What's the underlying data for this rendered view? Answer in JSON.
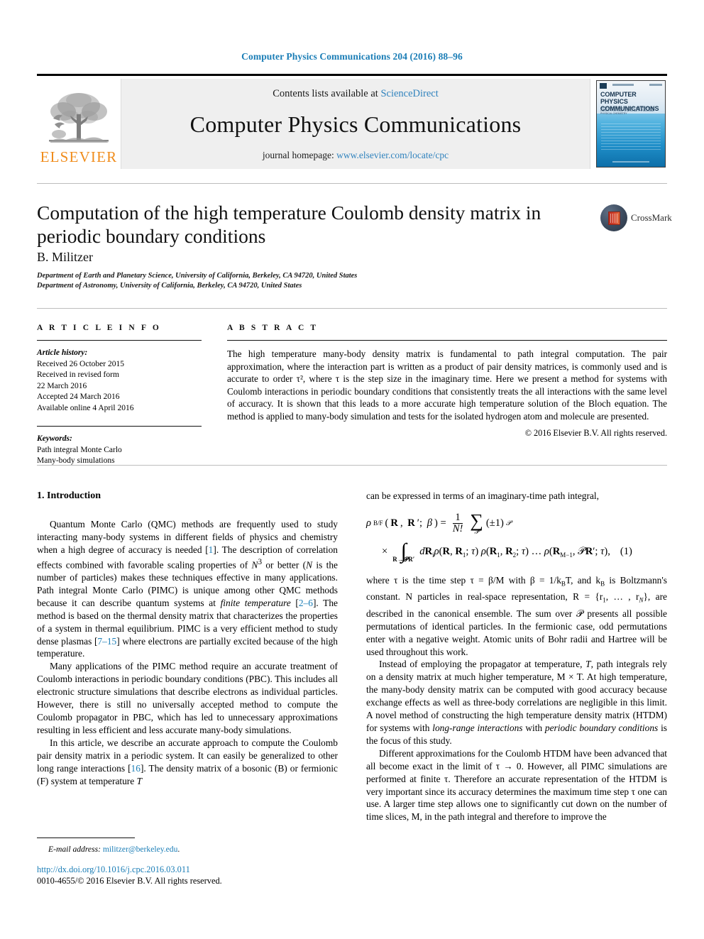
{
  "running_head": "Computer Physics Communications 204 (2016) 88–96",
  "masthead": {
    "elsevier_wordmark": "ELSEVIER",
    "contents_prefix": "Contents lists available at ",
    "contents_link": "ScienceDirect",
    "journal_name": "Computer Physics Communications",
    "homepage_prefix": "journal homepage: ",
    "homepage_link": "www.elsevier.com/locate/cpc",
    "cover_title_line1": "COMPUTER PHYSICS",
    "cover_title_line2": "COMMUNICATIONS",
    "cover_subtitle": "AN INTERNATIONAL JOURNAL AND PROGRAM LIBRARY FOR COMPUTATIONAL PHYSICS AND PHYSICAL CHEMISTRY"
  },
  "article": {
    "title": "Computation of the high temperature Coulomb density matrix in periodic boundary conditions",
    "crossmark_label": "CrossMark",
    "author": "B. Militzer",
    "affiliation_1": "Department of Earth and Planetary Science, University of California, Berkeley, CA 94720, United States",
    "affiliation_2": "Department of Astronomy, University of California, Berkeley, CA 94720, United States"
  },
  "article_info": {
    "heading": "A R T I C L E   I N F O",
    "history_label": "Article history:",
    "history": [
      "Received 26 October 2015",
      "Received in revised form",
      "22 March 2016",
      "Accepted 24 March 2016",
      "Available online 4 April 2016"
    ],
    "keywords_label": "Keywords:",
    "keywords": [
      "Path integral Monte Carlo",
      "Many-body simulations"
    ]
  },
  "abstract": {
    "heading": "A B S T R A C T",
    "body": "The high temperature many-body density matrix is fundamental to path integral computation. The pair approximation, where the interaction part is written as a product of pair density matrices, is commonly used and is accurate to order τ², where τ is the step size in the imaginary time. Here we present a method for systems with Coulomb interactions in periodic boundary conditions that consistently treats the all interactions with the same level of accuracy. It is shown that this leads to a more accurate high temperature solution of the Bloch equation. The method is applied to many-body simulation and tests for the isolated hydrogen atom and molecule are presented.",
    "copyright": "© 2016 Elsevier B.V. All rights reserved."
  },
  "body": {
    "section_heading": "1. Introduction",
    "left_p1_a": "Quantum Monte Carlo (QMC) methods are frequently used to study interacting many-body systems in different fields of physics and chemistry when a high degree of accuracy is needed [",
    "left_p1_ref1": "1",
    "left_p1_b": "]. The description of correlation effects combined with favorable scaling properties of ",
    "left_p1_N3": "N",
    "left_p1_c": " or better (",
    "left_p1_N": "N",
    "left_p1_d": " is the number of particles) makes these techniques effective in many applications. Path integral Monte Carlo (PIMC) is unique among other QMC methods because it can describe quantum systems at ",
    "left_p1_em": "finite temperature",
    "left_p1_e": " [",
    "left_p1_ref2": "2–6",
    "left_p1_f": "]. The method is based on the thermal density matrix that characterizes the properties of a system in thermal equilibrium. PIMC is a very efficient method to study dense plasmas [",
    "left_p1_ref3": "7–15",
    "left_p1_g": "] where electrons are partially excited because of the high temperature.",
    "left_p2": "Many applications of the PIMC method require an accurate treatment of Coulomb interactions in periodic boundary conditions (PBC). This includes all electronic structure simulations that describe electrons as individual particles. However, there is still no universally accepted method to compute the Coulomb propagator in PBC, which has led to unnecessary approximations resulting in less efficient and less accurate many-body simulations.",
    "left_p3_a": "In this article, we describe an accurate approach to compute the Coulomb pair density matrix in a periodic system. It can easily be generalized to other long range interactions [",
    "left_p3_ref": "16",
    "left_p3_b": "]. The density matrix of a bosonic (B) or fermionic (F) system at temperature ",
    "left_p3_T": "T",
    "right_p1": "can be expressed in terms of an imaginary-time path integral,",
    "equation_number": "(1)",
    "right_p2_a": "where τ is the time step τ = β/M with β = 1/k",
    "right_p2_b": "T, and k",
    "right_p2_c": " is Boltzmann's constant. N particles in real-space representation, R = {r",
    "right_p2_d": ", … , r",
    "right_p2_e": "}, are described in the canonical ensemble. The sum over 𝒫 presents all possible permutations of identical particles. In the fermionic case, odd permutations enter with a negative weight. Atomic units of Bohr radii and Hartree will be used throughout this work.",
    "right_p3_a": "Instead of employing the propagator at temperature, ",
    "right_p3_T": "T",
    "right_p3_b": ", path integrals rely on a density matrix at much higher temperature, M × T. At high temperature, the many-body density matrix can be computed with good accuracy because exchange effects as well as three-body correlations are negligible in this limit. A novel method of constructing the high temperature density matrix (HTDM) for systems with ",
    "right_p3_em1": "long-range interactions",
    "right_p3_c": " with ",
    "right_p3_em2": "periodic boundary conditions",
    "right_p3_d": " is the focus of this study.",
    "right_p4": "Different approximations for the Coulomb HTDM have been advanced that all become exact in the limit of τ → 0. However, all PIMC simulations are performed at finite τ. Therefore an accurate representation of the HTDM is very important since its accuracy determines the maximum time step τ one can use. A larger time step allows one to significantly cut down on the number of time slices, M, in the path integral and therefore to improve the"
  },
  "footer": {
    "email_label": "E-mail address:",
    "email": "militzer@berkeley.edu",
    "email_suffix": ".",
    "doi": "http://dx.doi.org/10.1016/j.cpc.2016.03.011",
    "issn_copyright": "0010-4655/© 2016 Elsevier B.V. All rights reserved."
  },
  "colors": {
    "link_blue": "#1a7db6",
    "sd_blue": "#2f82bd",
    "elsevier_orange": "#f08c1b"
  }
}
